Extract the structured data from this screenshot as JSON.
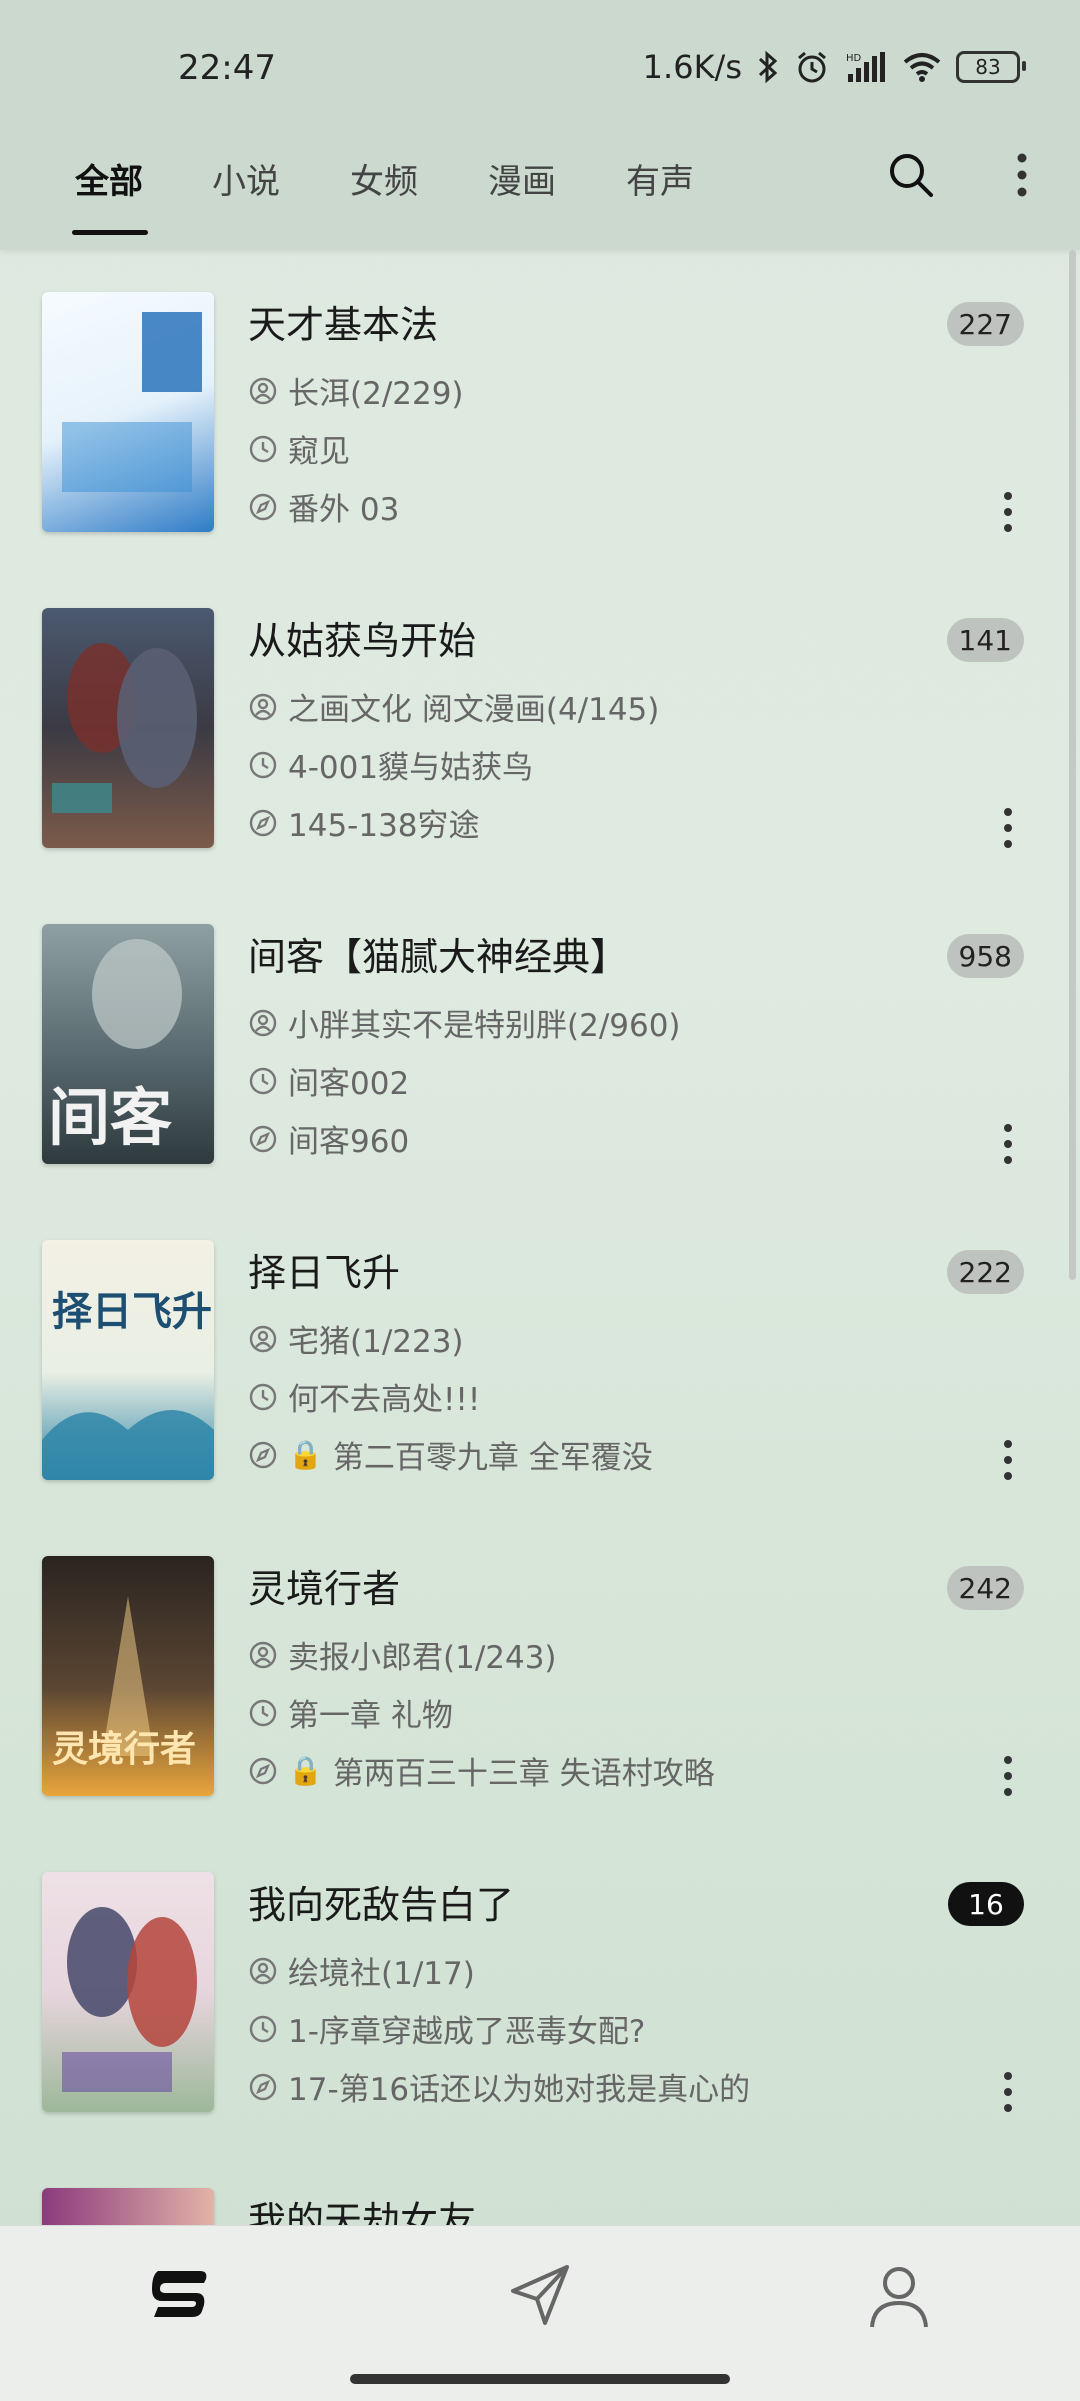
{
  "status": {
    "time": "22:47",
    "speed": "1.6K/s",
    "battery": "83"
  },
  "tabs": [
    "全部",
    "小说",
    "女频",
    "漫画",
    "有声"
  ],
  "books": [
    {
      "title": "天才基本法",
      "count": "227",
      "author": "长洱(2/229)",
      "recent": "窥见",
      "latest": "番外 03",
      "locked": false,
      "cover_colors": [
        "#2f7cc7",
        "#ffffff"
      ]
    },
    {
      "title": "从姑获鸟开始",
      "count": "141",
      "author": "之画文化 阅文漫画(4/145)",
      "recent": "4-001貘与姑获鸟",
      "latest": "145-138穷途",
      "locked": false,
      "cover_colors": [
        "#3b3a44",
        "#8a6b5c"
      ]
    },
    {
      "title": "间客【猫腻大神经典】",
      "count": "958",
      "author": "小胖其实不是特别胖(2/960)",
      "recent": "间客002",
      "latest": "间客960",
      "locked": false,
      "cover_colors": [
        "#53646a",
        "#a5b1b0"
      ]
    },
    {
      "title": "择日飞升",
      "count": "222",
      "author": "宅猪(1/223)",
      "recent": "何不去高处!!!",
      "latest": "第二百零九章 全军覆没",
      "locked": true,
      "cover_colors": [
        "#f3f0e4",
        "#2f86a8"
      ]
    },
    {
      "title": "灵境行者",
      "count": "242",
      "author": "卖报小郎君(1/243)",
      "recent": "第一章 礼物",
      "latest": "第两百三十三章 失语村攻略",
      "locked": true,
      "cover_colors": [
        "#2a2420",
        "#e8a53c"
      ]
    },
    {
      "title": "我向死敌告白了",
      "count": "16",
      "author": "绘境社(1/17)",
      "recent": "1-序章穿越成了恶毒女配?",
      "latest": "17-第16话还以为她对我是真心的",
      "locked": false,
      "dark_badge": true,
      "cover_colors": [
        "#e7d5dd",
        "#b4453c"
      ]
    },
    {
      "title": "我的天劫女友",
      "count": "",
      "author": "",
      "recent": "",
      "latest": "",
      "locked": false,
      "cover_colors": [
        "#8b3a7c",
        "#e2b3a8"
      ]
    }
  ],
  "icons": {
    "search": "search-icon",
    "more": "more-vertical-icon",
    "author": "user-circle-icon",
    "recent": "clock-icon",
    "latest": "compass-icon",
    "bookshelf": "bookshelf-nav-icon",
    "discover": "navigation-arrow-icon",
    "profile": "person-icon"
  },
  "lock_symbol": "🔒"
}
